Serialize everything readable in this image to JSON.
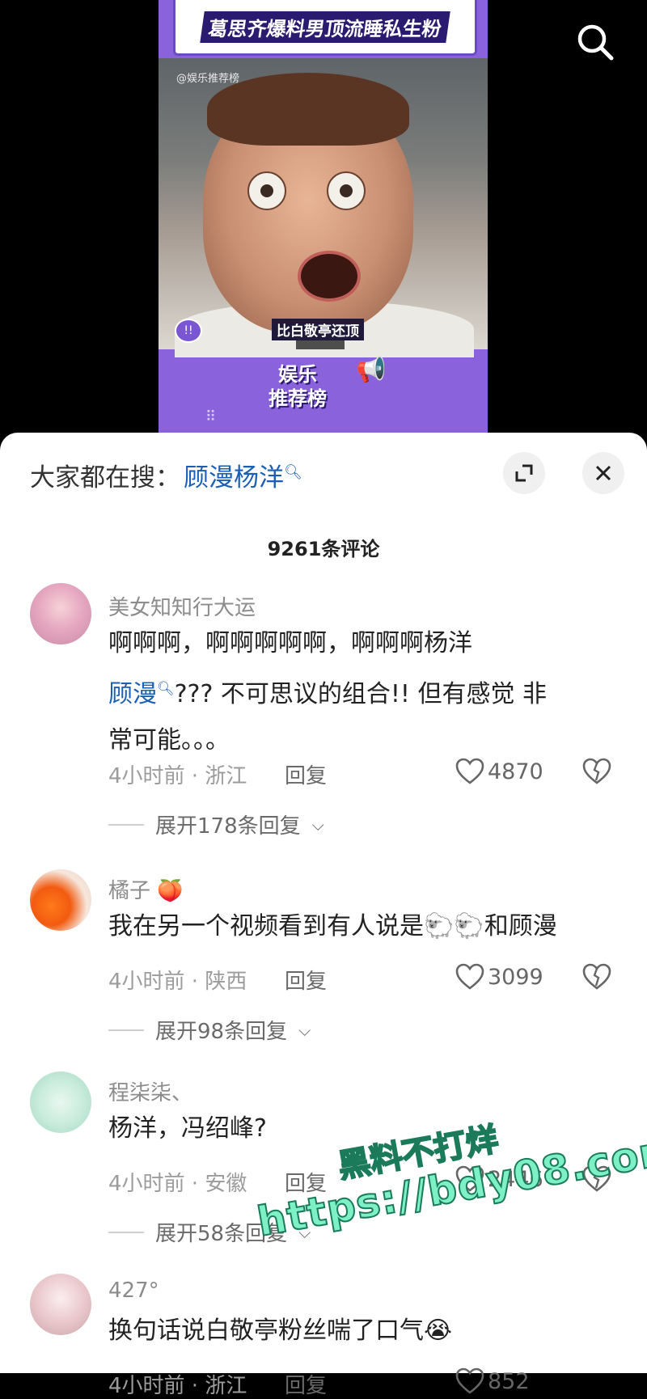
{
  "video": {
    "title_banner": "葛思齐爆料男顶流睡私生粉",
    "handle": "@娱乐推荐榜",
    "subtitle": "比白敬亭还顶",
    "brand_line1": "娱乐",
    "brand_line2": "推荐榜"
  },
  "sheet": {
    "hot_search_label": "大家都在搜：",
    "hot_search_term": "顾漫杨洋",
    "comment_count": "9261条评论"
  },
  "comments": [
    {
      "username": "美女知知行大运",
      "text_line1": "啊啊啊，啊啊啊啊啊，啊啊啊杨洋",
      "text_link": "顾漫",
      "text_line2_rest": "??? 不可思议的组合!! 但有感觉 非",
      "text_line3": "常可能。。。",
      "meta": "4小时前 · 浙江",
      "reply_label": "回复",
      "likes": "4870",
      "expand": "展开178条回复"
    },
    {
      "username": "橘子",
      "text_before": "我在另一个视频看到有人说是",
      "text_after": "和顾漫",
      "meta": "4小时前 · 陕西",
      "reply_label": "回复",
      "likes": "3099",
      "expand": "展开98条回复"
    },
    {
      "username": "程柒柒、",
      "text": "杨洋，冯绍峰?",
      "meta": "4小时前 · 安徽",
      "reply_label": "回复",
      "likes": "2446",
      "expand": "展开58条回复"
    },
    {
      "username": "427°",
      "text": "换句话说白敬亭粉丝喘了口气",
      "meta": "4小时前 · 浙江",
      "reply_label": "回复",
      "likes": "852"
    }
  ],
  "watermark": {
    "line1": "黑料不打烊",
    "line2": "https://bdy08.com"
  },
  "colors": {
    "video_purple": "#8a62dc",
    "link_blue": "#1a5fb4",
    "watermark_green": "#7ef0c6"
  }
}
